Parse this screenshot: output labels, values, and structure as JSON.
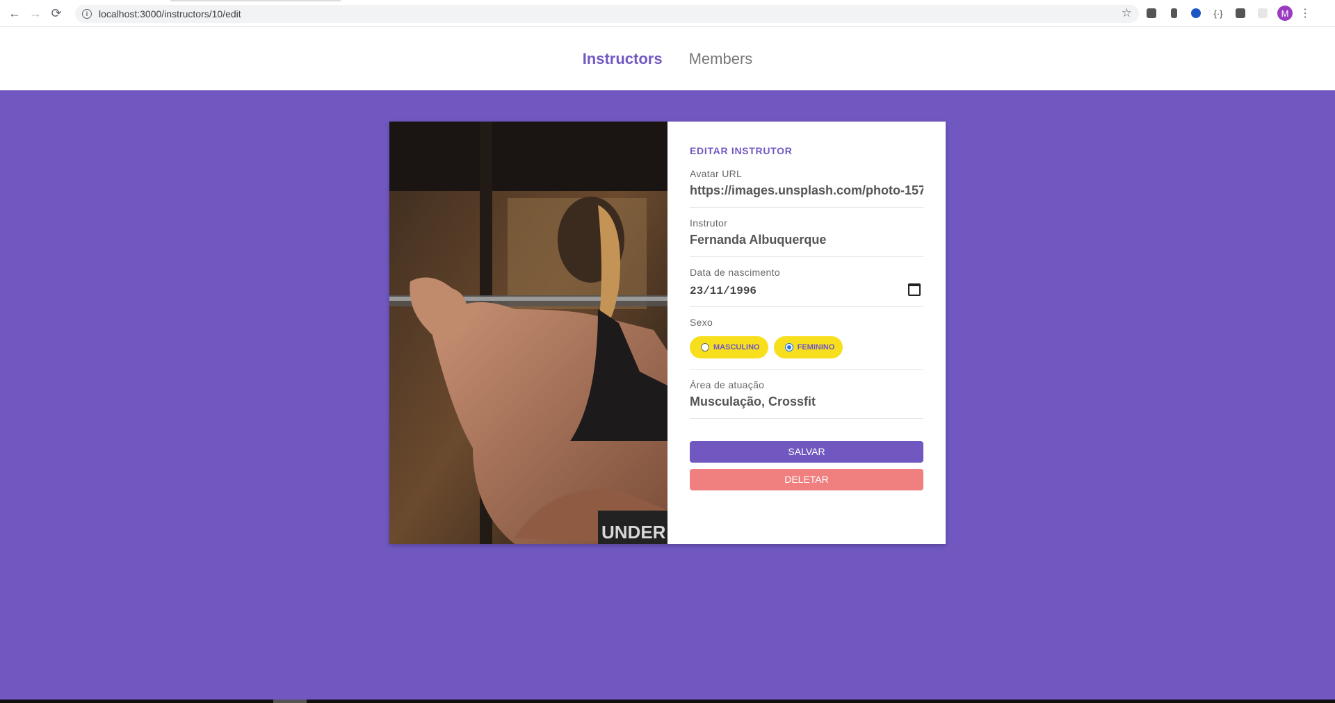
{
  "browser": {
    "url": "localhost:3000/instructors/10/edit",
    "back_icon": "←",
    "forward_icon": "→",
    "reload_icon": "⟳",
    "info_icon": "i",
    "star_icon": "☆",
    "extension_text": "{·}",
    "profile_initial": "M",
    "menu_icon": "⋮"
  },
  "nav": {
    "items": [
      {
        "label": "Instructors",
        "active": true
      },
      {
        "label": "Members",
        "active": false
      }
    ]
  },
  "form": {
    "title": "EDITAR INSTRUTOR",
    "avatar_url": {
      "label": "Avatar URL",
      "value": "https://images.unsplash.com/photo-157"
    },
    "instructor": {
      "label": "Instrutor",
      "value": "Fernanda Albuquerque"
    },
    "birth": {
      "label": "Data de nascimento",
      "value": "23/11/1996"
    },
    "gender": {
      "label": "Sexo",
      "options": [
        {
          "label": "MASCULINO",
          "checked": false
        },
        {
          "label": "FEMININO",
          "checked": true
        }
      ]
    },
    "area": {
      "label": "Área de atuação",
      "value": "Musculação, Crossfit"
    },
    "save_label": "SALVAR",
    "delete_label": "DELETAR"
  },
  "photo_text": "UNDER AR",
  "colors": {
    "primary": "#7158c1",
    "accent_yellow": "#f7df1e",
    "delete": "#f08080"
  }
}
